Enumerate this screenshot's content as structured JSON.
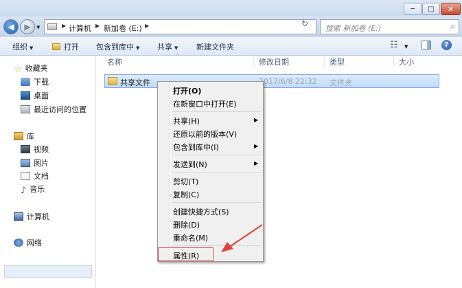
{
  "window": {
    "minimize_glyph": "─",
    "maximize_glyph": "□",
    "close_glyph": "✕"
  },
  "address": {
    "back_glyph": "◀",
    "forward_glyph": "▶",
    "recent_glyph": "▼",
    "segments": [
      "计算机",
      "新加卷 (E:)"
    ],
    "separator": "▶",
    "dropdown_glyph": "▼",
    "refresh_glyph": "↻"
  },
  "search": {
    "placeholder": "搜索 新加卷 (E:)",
    "icon": "search-icon",
    "icon_glyph": "⌕"
  },
  "toolbar": {
    "organize": "组织",
    "open": "打开",
    "include_in_library": "包含到库中",
    "share": "共享",
    "new_folder": "新建文件夹",
    "caret": "▼",
    "view_glyph": "☷",
    "help_glyph": "?"
  },
  "nav": {
    "favorites": "收藏夹",
    "downloads": "下载",
    "desktop": "桌面",
    "recent": "最近访问的位置",
    "libraries": "库",
    "videos": "视频",
    "pictures": "图片",
    "documents": "文档",
    "music": "音乐",
    "computer": "计算机",
    "network": "网络",
    "star_glyph": "☆",
    "music_glyph": "♪"
  },
  "columns": {
    "name": "名称",
    "modified": "修改日期",
    "type": "类型",
    "size": "大小",
    "sort_glyph": "^"
  },
  "file": {
    "name": "共享文件",
    "modified": "2017/6/8 22:32",
    "type": "文件夹"
  },
  "context_menu": {
    "open": "打开(O)",
    "open_new_window": "在新窗口中打开(E)",
    "share": "共享(H)",
    "restore": "还原以前的版本(V)",
    "include_library": "包含到库中(I)",
    "send_to": "发送到(N)",
    "cut": "剪切(T)",
    "copy": "复制(C)",
    "create_shortcut": "创建快捷方式(S)",
    "delete": "删除(D)",
    "rename": "重命名(M)",
    "properties": "属性(R)",
    "submenu_glyph": "▶"
  },
  "colors": {
    "highlight_box": "#e0413a",
    "selection": "#c1dcf8",
    "annotation_arrow": "#e0413a"
  }
}
